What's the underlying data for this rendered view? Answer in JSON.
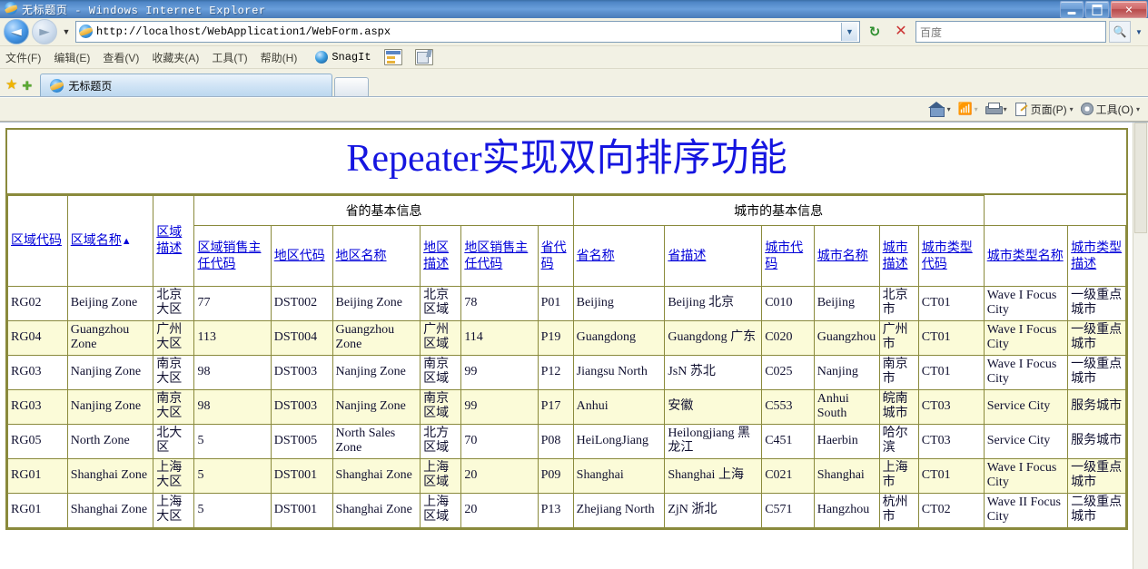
{
  "window": {
    "title": "无标题页 - Windows Internet Explorer",
    "minimize_label": "",
    "maximize_label": "",
    "close_label": "✕"
  },
  "address_bar": {
    "back_label": "◄",
    "forward_label": "►",
    "history_dropdown_label": "▼",
    "url": "http://localhost/WebApplication1/WebForm.aspx",
    "url_dropdown_label": "▼",
    "refresh_label": "↻",
    "stop_label": "✕",
    "search_placeholder": "百度",
    "search_value": "",
    "search_go_label": "🔍",
    "search_dropdown_label": "▼"
  },
  "menu_bar": {
    "items": [
      {
        "label": "文件(F)"
      },
      {
        "label": "编辑(E)"
      },
      {
        "label": "查看(V)"
      },
      {
        "label": "收藏夹(A)"
      },
      {
        "label": "工具(T)"
      },
      {
        "label": "帮助(H)"
      }
    ],
    "snagit_label": "SnagIt"
  },
  "tab_bar": {
    "favorites_label": "★",
    "add_favorites_label": "✚",
    "tabs": [
      {
        "label": "无标题页",
        "active": true
      }
    ],
    "new_tab_label": ""
  },
  "command_bar": {
    "home_label": "",
    "feeds_label": "",
    "print_label": "",
    "page_label": "页面(P)",
    "tools_label": "工具(O)",
    "caret": "▾"
  },
  "page": {
    "title": "Repeater实现双向排序功能",
    "group_headers": [
      {
        "label": "省的基本信息",
        "colspan": 6
      },
      {
        "label": "城市的基本信息",
        "colspan": 6
      }
    ],
    "columns": [
      {
        "label": "区域代码",
        "sort": ""
      },
      {
        "label": "区域名称",
        "sort": "▲"
      },
      {
        "label": "区域描述",
        "sort": ""
      },
      {
        "label": "区域销售主任代码",
        "sort": ""
      },
      {
        "label": "地区代码",
        "sort": ""
      },
      {
        "label": "地区名称",
        "sort": ""
      },
      {
        "label": "地区描述",
        "sort": ""
      },
      {
        "label": "地区销售主任代码",
        "sort": ""
      },
      {
        "label": "省代码",
        "sort": ""
      },
      {
        "label": "省名称",
        "sort": ""
      },
      {
        "label": "省描述",
        "sort": ""
      },
      {
        "label": "城市代码",
        "sort": ""
      },
      {
        "label": "城市名称",
        "sort": ""
      },
      {
        "label": "城市描述",
        "sort": ""
      },
      {
        "label": "城市类型代码",
        "sort": ""
      },
      {
        "label": "城市类型名称",
        "sort": ""
      },
      {
        "label": "城市类型描述",
        "sort": ""
      }
    ],
    "rows": [
      [
        "RG02",
        "Beijing Zone",
        "北京大区",
        "77",
        "DST002",
        "Beijing Zone",
        "北京区域",
        "78",
        "P01",
        "Beijing",
        "Beijing 北京",
        "C010",
        "Beijing",
        "北京市",
        "CT01",
        "Wave I Focus City",
        "一级重点城市"
      ],
      [
        "RG04",
        "Guangzhou Zone",
        "广州大区",
        "113",
        "DST004",
        "Guangzhou Zone",
        "广州区域",
        "114",
        "P19",
        "Guangdong",
        "Guangdong 广东",
        "C020",
        "Guangzhou",
        "广州市",
        "CT01",
        "Wave I Focus City",
        "一级重点城市"
      ],
      [
        "RG03",
        "Nanjing Zone",
        "南京大区",
        "98",
        "DST003",
        "Nanjing Zone",
        "南京区域",
        "99",
        "P12",
        "Jiangsu North",
        "JsN 苏北",
        "C025",
        "Nanjing",
        "南京市",
        "CT01",
        "Wave I Focus City",
        "一级重点城市"
      ],
      [
        "RG03",
        "Nanjing Zone",
        "南京大区",
        "98",
        "DST003",
        "Nanjing Zone",
        "南京区域",
        "99",
        "P17",
        "Anhui",
        "安徽",
        "C553",
        "Anhui South",
        "皖南城市",
        "CT03",
        "Service City",
        "服务城市"
      ],
      [
        "RG05",
        "North Zone",
        "北大区",
        "5",
        "DST005",
        "North Sales Zone",
        "北方区域",
        "70",
        "P08",
        "HeiLongJiang",
        "Heilongjiang 黑龙江",
        "C451",
        "Haerbin",
        "哈尔滨",
        "CT03",
        "Service City",
        "服务城市"
      ],
      [
        "RG01",
        "Shanghai Zone",
        "上海大区",
        "5",
        "DST001",
        "Shanghai Zone",
        "上海区域",
        "20",
        "P09",
        "Shanghai",
        "Shanghai 上海",
        "C021",
        "Shanghai",
        "上海市",
        "CT01",
        "Wave I Focus City",
        "一级重点城市"
      ],
      [
        "RG01",
        "Shanghai Zone",
        "上海大区",
        "5",
        "DST001",
        "Shanghai Zone",
        "上海区域",
        "20",
        "P13",
        "Zhejiang North",
        "ZjN 浙北",
        "C571",
        "Hangzhou",
        "杭州市",
        "CT02",
        "Wave II Focus City",
        "二级重点城市"
      ]
    ]
  },
  "colors": {
    "title_text": "#1515e0",
    "link": "#0000d8",
    "border": "#8a8a3c",
    "alt_row": "#fbfbd8"
  }
}
